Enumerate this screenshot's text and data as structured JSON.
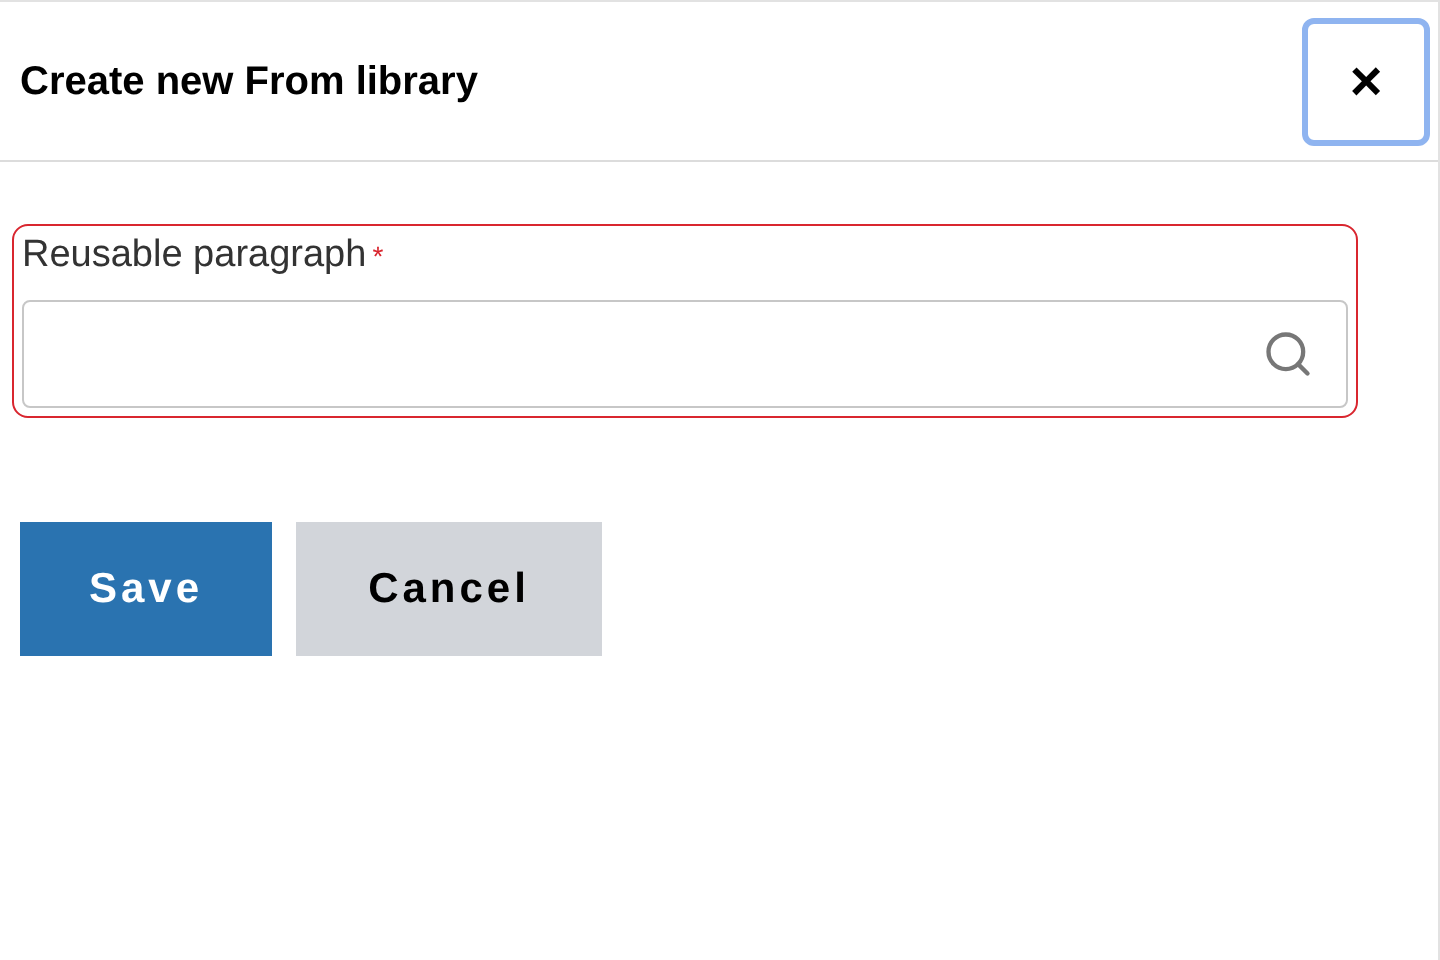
{
  "dialog": {
    "title": "Create new From library",
    "close_button": {
      "label": "×",
      "focused": true
    }
  },
  "field": {
    "label": "Reusable paragraph",
    "required_mark": "*",
    "invalid": true
  },
  "buttons": [
    {
      "label": "Save",
      "kind": "primary"
    },
    {
      "label": "Cancel",
      "kind": "secondary"
    }
  ]
}
